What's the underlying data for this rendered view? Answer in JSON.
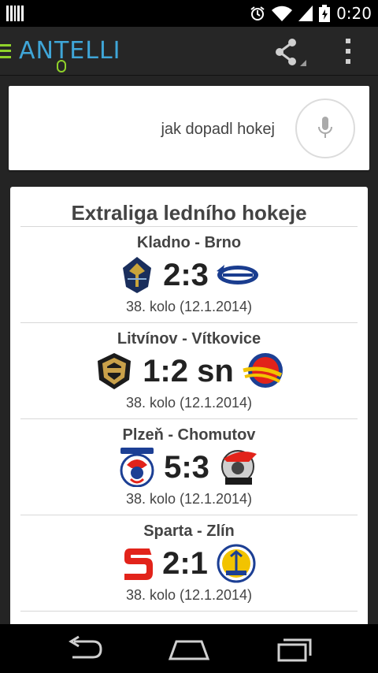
{
  "statusbar": {
    "time": "0:20"
  },
  "app": {
    "logo_text": "ANTELLI"
  },
  "search": {
    "query": "jak dopadl hokej"
  },
  "results": {
    "title": "Extraliga ledního hokeje",
    "matches": [
      {
        "teams": "Kladno - Brno",
        "score": "2:3",
        "round": "38. kolo  (12.1.2014)",
        "home_logo": "kladno-logo",
        "away_logo": "kometa-brno-logo"
      },
      {
        "teams": "Litvínov - Vítkovice",
        "score": "1:2  sn",
        "round": "38. kolo  (12.1.2014)",
        "home_logo": "hc-verva-litvinov-logo",
        "away_logo": "vitkovice-logo"
      },
      {
        "teams": "Plzeň - Chomutov",
        "score": "5:3",
        "round": "38. kolo  (12.1.2014)",
        "home_logo": "hc-plzen-logo",
        "away_logo": "pirati-chomutov-logo"
      },
      {
        "teams": "Sparta - Zlín",
        "score": "2:1",
        "round": "38. kolo  (12.1.2014)",
        "home_logo": "sparta-logo",
        "away_logo": "zlin-logo"
      }
    ]
  },
  "colors": {
    "accent_green": "#8fd12a",
    "logo_blue": "#3fa6d8",
    "sparta_red": "#e2231a"
  }
}
